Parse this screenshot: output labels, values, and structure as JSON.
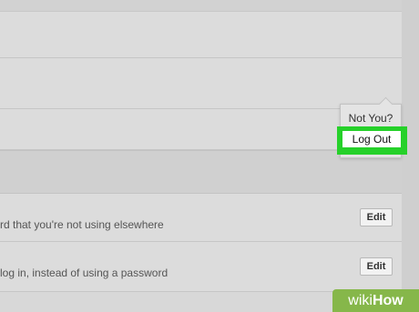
{
  "session": {
    "menu": {
      "not_you_label": "Not You?",
      "log_out_label": "Log Out"
    }
  },
  "settings": [
    {
      "description": "rd that you're not using elsewhere",
      "edit_label": "Edit"
    },
    {
      "description": "log in, instead of using a password",
      "edit_label": "Edit"
    }
  ],
  "watermark": {
    "prefix": "wiki",
    "suffix": "How"
  },
  "colors": {
    "highlight": "#26d12a",
    "watermark_bg": "#86b74a"
  }
}
